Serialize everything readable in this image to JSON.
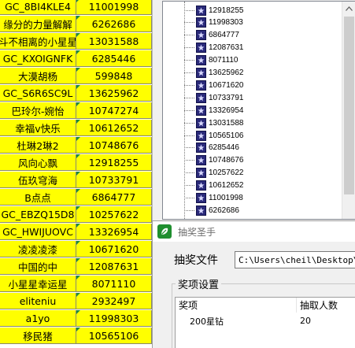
{
  "spreadsheet": {
    "rows": [
      {
        "name": "GC_8BI4KLE4",
        "number": "11001998"
      },
      {
        "name": "缘分的力量解解",
        "number": "6262686"
      },
      {
        "name": "斗不相离的小星星",
        "number": "13031588"
      },
      {
        "name": "GC_KXOIGNFK",
        "number": "6285446"
      },
      {
        "name": "大漠胡杨",
        "number": "599848"
      },
      {
        "name": "GC_S6R6SC9L",
        "number": "13625962"
      },
      {
        "name": "巴玲尔-婉怡",
        "number": "10747274"
      },
      {
        "name": "幸福v快乐",
        "number": "10612652"
      },
      {
        "name": "杜琳2琳2",
        "number": "10748676"
      },
      {
        "name": "风向心飘",
        "number": "12918255"
      },
      {
        "name": "伍玖穹海",
        "number": "10733791"
      },
      {
        "name": "B点点",
        "number": "6864777"
      },
      {
        "name": "GC_EBZQ15D8",
        "number": "10257622"
      },
      {
        "name": "GC_HWIJUOVC",
        "number": "13326954"
      },
      {
        "name": "凌凌凌漆",
        "number": "10671620"
      },
      {
        "name": "中国的中",
        "number": "12087631"
      },
      {
        "name": "小星星幸运星",
        "number": "8071110"
      },
      {
        "name": "eliteniu",
        "number": "2932497"
      },
      {
        "name": "a1yo",
        "number": "11998303"
      },
      {
        "name": "移民猪",
        "number": "10565106"
      }
    ]
  },
  "tree": {
    "items": [
      "12918255",
      "11998303",
      "6864777",
      "12087631",
      "8071110",
      "13625962",
      "10671620",
      "10733791",
      "13326954",
      "13031588",
      "10565106",
      "6285446",
      "10748676",
      "10257622",
      "10612652",
      "11001998",
      "6262686"
    ]
  },
  "dialog": {
    "title": "抽奖圣手",
    "file_label": "抽奖文件",
    "file_path": "C:\\Users\\cheil\\Desktop\\版",
    "group_label": "奖项设置",
    "columns": [
      "奖项",
      "抽取人数"
    ],
    "rows": [
      {
        "prize": "200星钻",
        "count": "20"
      }
    ]
  },
  "colors": {
    "cell_fill": "#ffff00",
    "comment_marker": "#1e8a3c",
    "tree_node_icon": "#2a2a7a",
    "app_icon": "#1f8f2f"
  }
}
